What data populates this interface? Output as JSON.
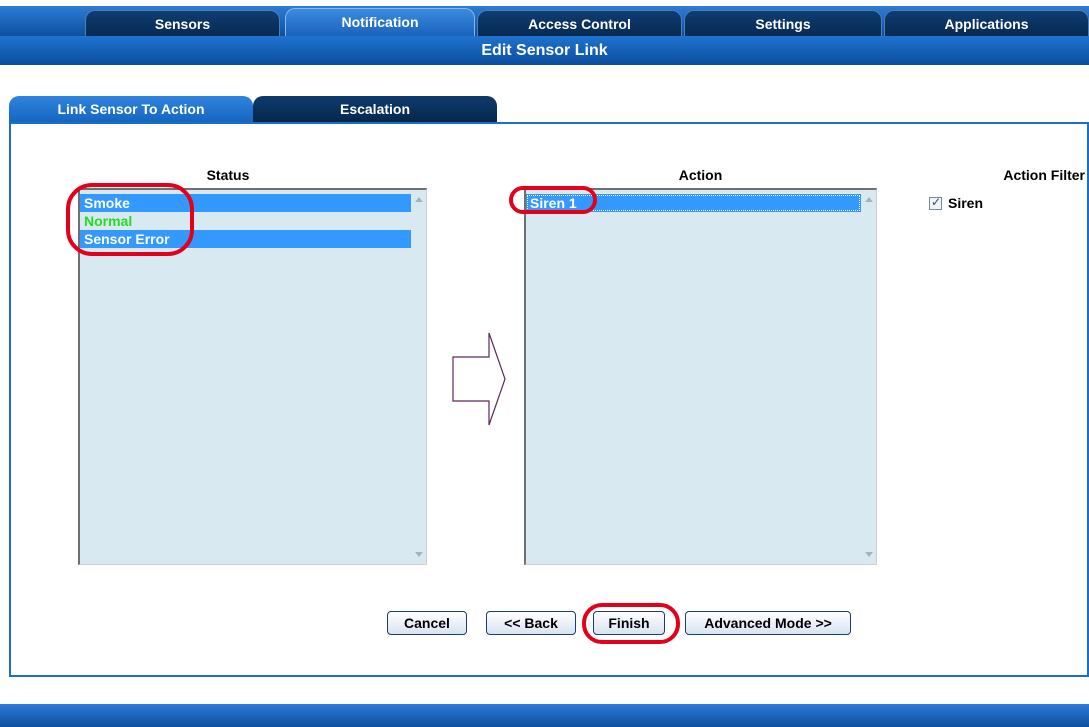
{
  "nav": {
    "tabs": [
      {
        "label": "Sensors"
      },
      {
        "label": "Notification"
      },
      {
        "label": "Access Control"
      },
      {
        "label": "Settings"
      },
      {
        "label": "Applications"
      }
    ]
  },
  "page": {
    "title": "Edit Sensor Link"
  },
  "subtabs": [
    {
      "label": "Link Sensor To Action"
    },
    {
      "label": "Escalation"
    }
  ],
  "status": {
    "title": "Status",
    "items": [
      {
        "label": "Smoke"
      },
      {
        "label": "Normal"
      },
      {
        "label": "Sensor Error"
      }
    ]
  },
  "action": {
    "title": "Action",
    "items": [
      {
        "label": "Siren 1"
      }
    ]
  },
  "filter": {
    "title": "Action Filter",
    "siren_label": "Siren",
    "siren_checked": true
  },
  "buttons": {
    "cancel": "Cancel",
    "back": "<< Back",
    "finish": "Finish",
    "advanced": "Advanced Mode >>"
  },
  "colors": {
    "selection": "#3399ff",
    "normal_text": "#22dd22",
    "annotation": "#e3001b"
  }
}
